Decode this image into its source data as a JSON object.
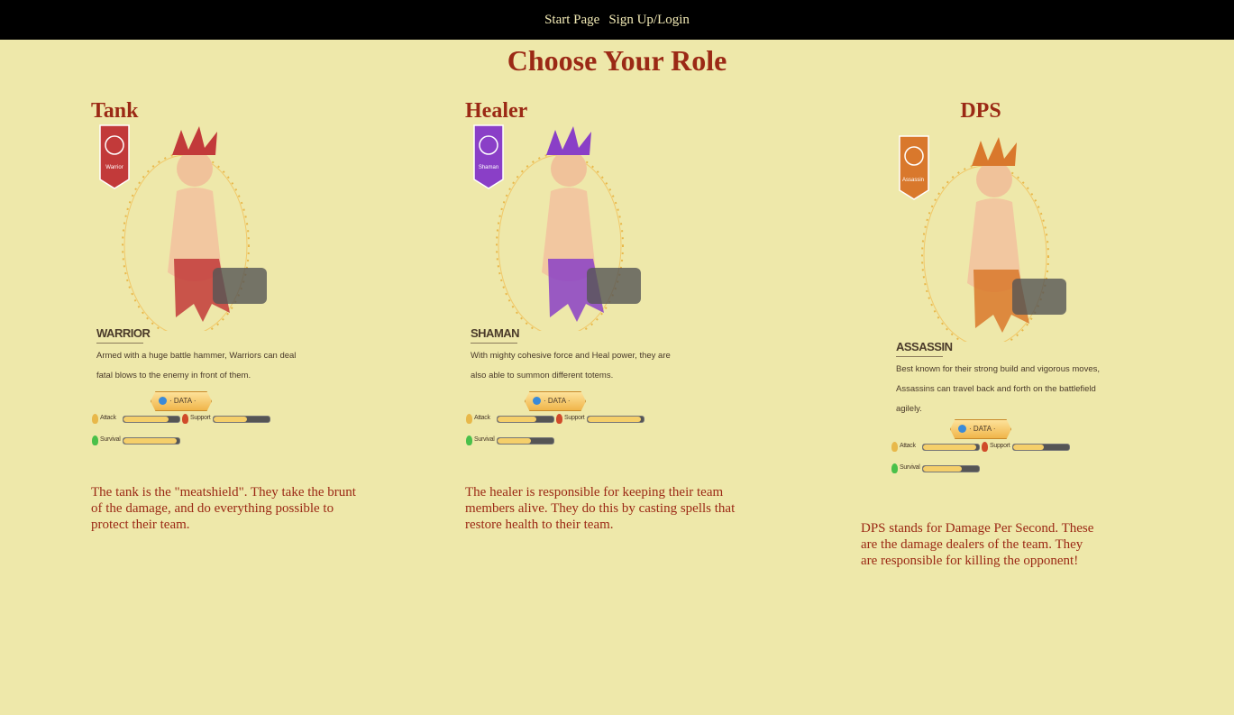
{
  "nav": {
    "items": [
      "Start Page",
      "Sign Up/Login"
    ]
  },
  "page_title": "Choose Your Role",
  "roles": [
    {
      "heading": "Tank",
      "card": {
        "badge": "Warrior",
        "class_name": "WARRIOR",
        "desc_line1": "Armed with a huge battle hammer, Warriors can deal",
        "desc_line2": "fatal blows to the enemy in front of them.",
        "data_label": "· DATA ·",
        "attack_label": "Attack",
        "support_label": "Support",
        "survival_label": "Survival",
        "attack": 0.8,
        "support": 0.6,
        "survival": 0.95,
        "accent": "#c23a3a"
      },
      "description": "The tank is the \"meatshield\". They take the brunt of the damage, and do everything possible to protect their team."
    },
    {
      "heading": "Healer",
      "card": {
        "badge": "Shaman",
        "class_name": "SHAMAN",
        "desc_line1": "With mighty cohesive force and Heal power, they are",
        "desc_line2": "also able to summon different totems.",
        "data_label": "· DATA ·",
        "attack_label": "Attack",
        "support_label": "Support",
        "survival_label": "Survival",
        "attack": 0.7,
        "support": 0.95,
        "survival": 0.6,
        "accent": "#8a3fc7"
      },
      "description": "The healer is responsible for keeping their team members alive. They do this by casting spells that restore health to their team."
    },
    {
      "heading": "DPS",
      "card": {
        "badge": "Assassin",
        "class_name": "ASSASSIN",
        "desc_line1": "Best known for their strong build and vigorous moves,",
        "desc_line2": "Assassins can travel back and forth on the battlefield",
        "desc_line3": "agilely.",
        "data_label": "· DATA ·",
        "attack_label": "Attack",
        "support_label": "Support",
        "survival_label": "Survival",
        "attack": 0.95,
        "support": 0.55,
        "survival": 0.7,
        "accent": "#d9782c"
      },
      "description": "DPS stands for Damage Per Second. These are the damage dealers of the team. They are responsible for killing the opponent!"
    }
  ]
}
